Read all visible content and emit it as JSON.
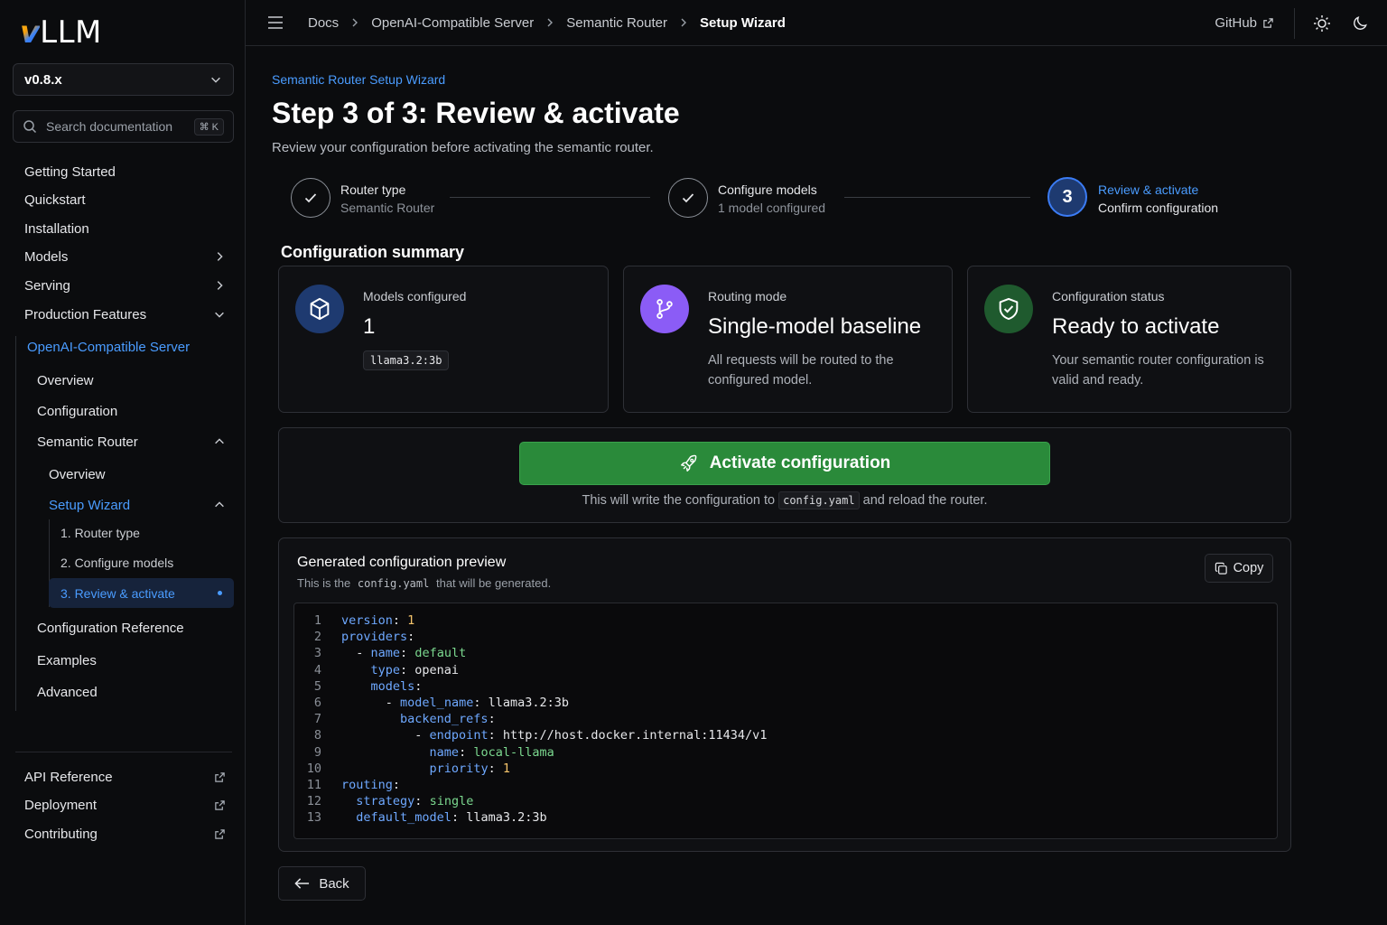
{
  "brand": {
    "logo_v": "v",
    "logo_text": "LLM"
  },
  "sidebar": {
    "version": "v0.8.x",
    "search_placeholder": "Search documentation",
    "search_shortcut": "⌘ K",
    "items": [
      {
        "label": "Getting Started"
      },
      {
        "label": "Quickstart"
      },
      {
        "label": "Installation"
      },
      {
        "label": "Models"
      },
      {
        "label": "Serving"
      },
      {
        "label": "Production Features"
      },
      {
        "label": "OpenAI-Compatible Server"
      },
      {
        "label": "Overview"
      },
      {
        "label": "Configuration"
      },
      {
        "label": "Semantic Router"
      },
      {
        "label": "Overview"
      },
      {
        "label": "Setup Wizard"
      },
      {
        "label": "1. Router type"
      },
      {
        "label": "2. Configure models"
      },
      {
        "label": "3. Review & activate"
      },
      {
        "label": "Configuration Reference"
      },
      {
        "label": "Examples"
      },
      {
        "label": "Advanced"
      }
    ],
    "footer_links": [
      {
        "label": "API Reference"
      },
      {
        "label": "Deployment"
      },
      {
        "label": "Contributing"
      }
    ]
  },
  "topbar": {
    "breadcrumbs": [
      "Docs",
      "OpenAI-Compatible Server",
      "Semantic Router",
      "Setup Wizard"
    ],
    "github_label": "GitHub"
  },
  "main": {
    "eyebrow": "Semantic Router Setup Wizard",
    "title": "Step 3 of 3: Review & activate",
    "subtitle": "Review your configuration before activating the semantic router.",
    "steps": [
      {
        "title": "Router type",
        "subtitle": "Semantic Router",
        "state": "done"
      },
      {
        "title": "Configure models",
        "subtitle": "1 model configured",
        "state": "done"
      },
      {
        "number": "3",
        "title": "Review & activate",
        "subtitle": "Confirm configuration",
        "state": "active"
      }
    ],
    "summary_title": "Configuration summary",
    "cards": [
      {
        "label": "Models configured",
        "value": "1",
        "chip": "llama3.2:3b",
        "icon": "cube-icon",
        "color": "#1e3a70"
      },
      {
        "label": "Routing mode",
        "value": "Single-model baseline",
        "desc": "All requests will be routed to the configured model.",
        "icon": "branch-icon",
        "color": "#8b5cf6"
      },
      {
        "label": "Configuration status",
        "value": "Ready to activate",
        "desc": "Your semantic router configuration is valid and ready.",
        "icon": "shield-check-icon",
        "color": "#1f5a2e"
      }
    ],
    "activate": {
      "label": "Activate configuration",
      "note_before": "This will write the configuration to",
      "note_code": "config.yaml",
      "note_after": "and reload the router."
    },
    "preview": {
      "title": "Generated configuration preview",
      "sub_before": "This is the",
      "sub_code": "config.yaml",
      "sub_after": "that will be generated.",
      "copy_label": "Copy",
      "lines": [
        {
          "n": "1",
          "indent": 0,
          "dash": false,
          "key": "version",
          "val": "1",
          "vtype": "n"
        },
        {
          "n": "2",
          "indent": 0,
          "dash": false,
          "key": "providers",
          "val": "",
          "vtype": "p"
        },
        {
          "n": "3",
          "indent": 1,
          "dash": true,
          "key": "name",
          "val": "default",
          "vtype": "s"
        },
        {
          "n": "4",
          "indent": 2,
          "dash": false,
          "key": "type",
          "val": "openai",
          "vtype": "p"
        },
        {
          "n": "5",
          "indent": 2,
          "dash": false,
          "key": "models",
          "val": "",
          "vtype": "p"
        },
        {
          "n": "6",
          "indent": 3,
          "dash": true,
          "key": "model_name",
          "val": "llama3.2:3b",
          "vtype": "p"
        },
        {
          "n": "7",
          "indent": 4,
          "dash": false,
          "key": "backend_refs",
          "val": "",
          "vtype": "p"
        },
        {
          "n": "8",
          "indent": 5,
          "dash": true,
          "key": "endpoint",
          "val": "http://host.docker.internal:11434/v1",
          "vtype": "p"
        },
        {
          "n": "9",
          "indent": 6,
          "dash": false,
          "key": "name",
          "val": "local-llama",
          "vtype": "s"
        },
        {
          "n": "10",
          "indent": 6,
          "dash": false,
          "key": "priority",
          "val": "1",
          "vtype": "n"
        },
        {
          "n": "11",
          "indent": 0,
          "dash": false,
          "key": "routing",
          "val": "",
          "vtype": "p"
        },
        {
          "n": "12",
          "indent": 1,
          "dash": false,
          "key": "strategy",
          "val": "single",
          "vtype": "s"
        },
        {
          "n": "13",
          "indent": 1,
          "dash": false,
          "key": "default_model",
          "val": "llama3.2:3b",
          "vtype": "p"
        }
      ]
    },
    "back_label": "Back"
  },
  "colors": {
    "accent": "#4a9cff",
    "activate_green": "#2a8a3a",
    "bg": "#0b0c0e"
  }
}
